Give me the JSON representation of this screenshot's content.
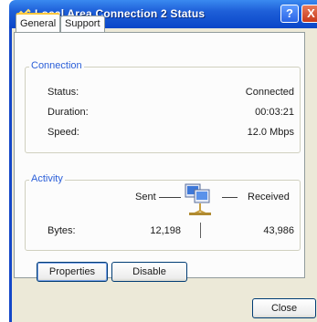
{
  "window": {
    "title": "Local Area Connection 2 Status",
    "help_label": "?",
    "close_label": "X"
  },
  "tabs": [
    {
      "label": "General",
      "selected": true
    },
    {
      "label": "Support",
      "selected": false
    }
  ],
  "connection": {
    "group_label": "Connection",
    "status_label": "Status:",
    "status_value": "Connected",
    "duration_label": "Duration:",
    "duration_value": "00:03:21",
    "speed_label": "Speed:",
    "speed_value": "12.0 Mbps"
  },
  "activity": {
    "group_label": "Activity",
    "sent_label": "Sent",
    "received_label": "Received",
    "bytes_label": "Bytes:",
    "bytes_sent": "12,198",
    "bytes_received": "43,986",
    "icon": "network-activity-icon"
  },
  "buttons": {
    "properties": "Properties",
    "disable": "Disable",
    "close": "Close"
  },
  "colors": {
    "titlebar": "#0a46c8",
    "group_label": "#2a5ed8",
    "tab_highlight": "#ffc73c"
  }
}
